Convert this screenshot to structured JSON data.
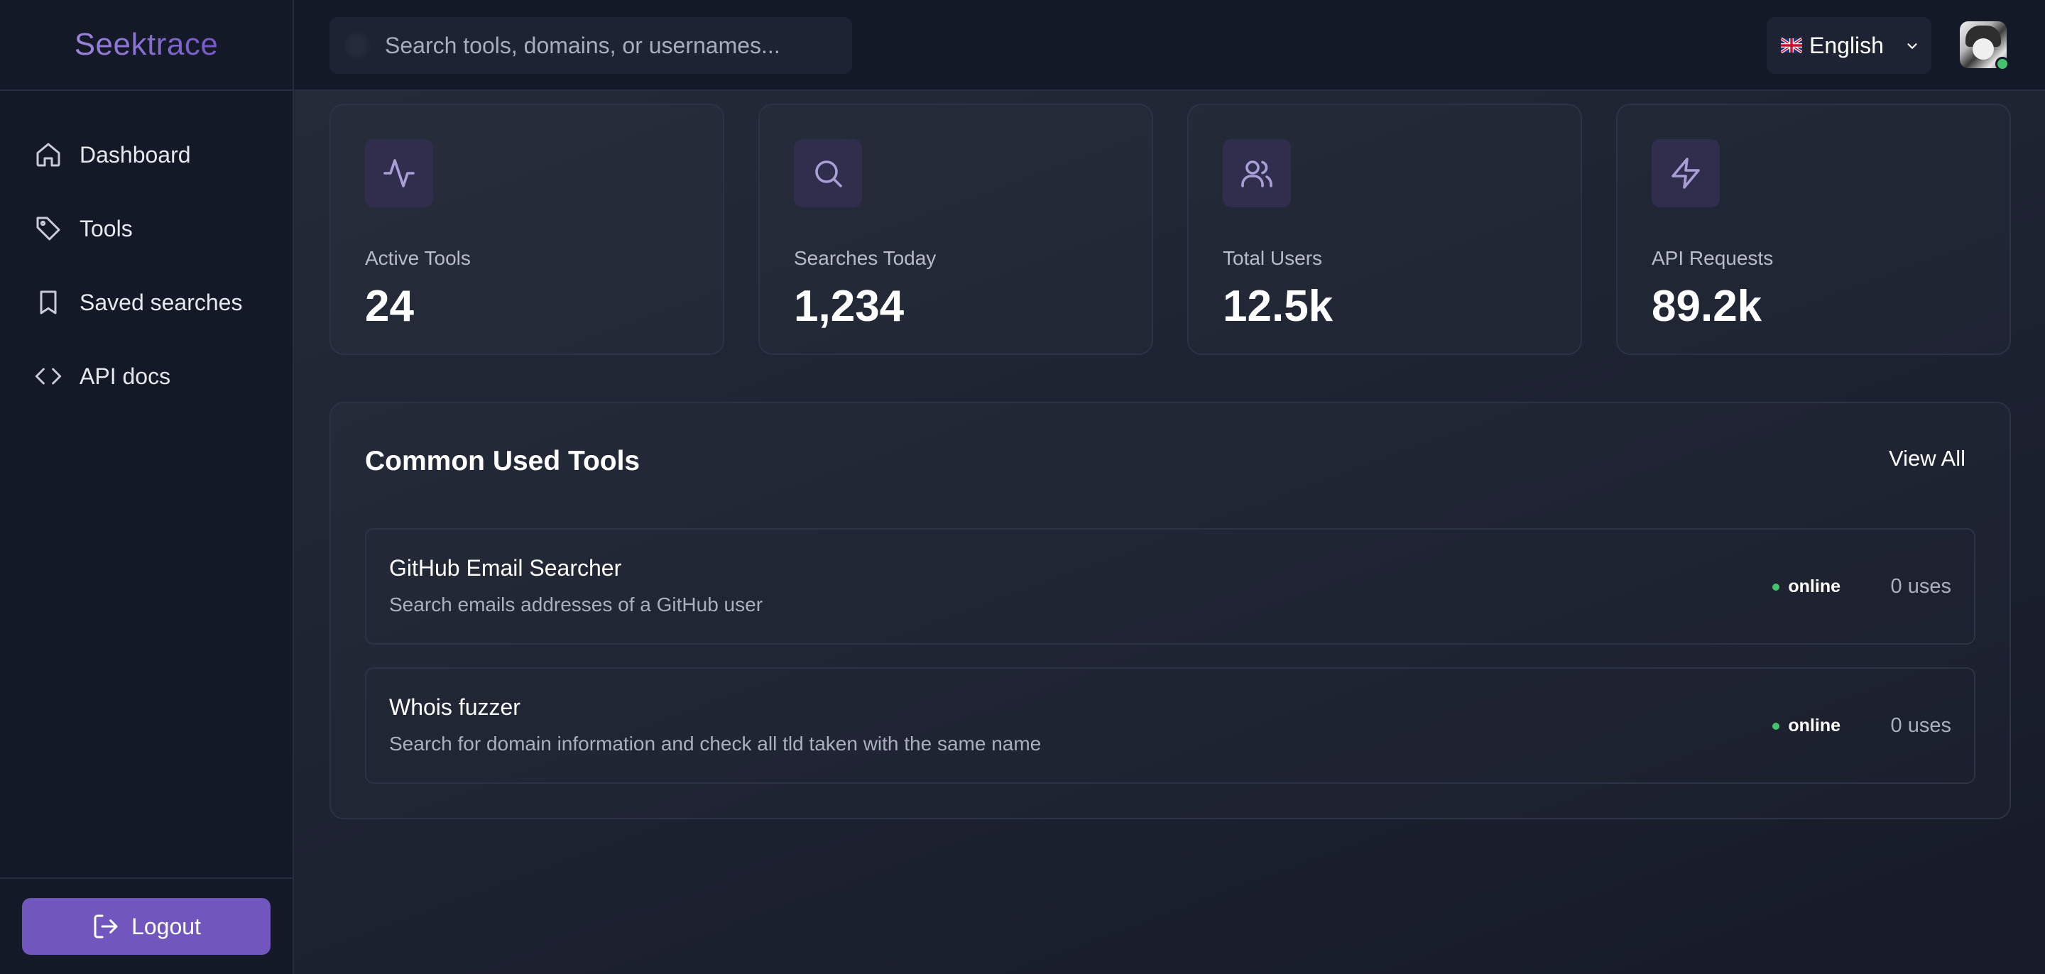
{
  "brand": {
    "name": "Seektrace"
  },
  "sidebar": {
    "items": [
      {
        "label": "Dashboard",
        "icon": "home-icon"
      },
      {
        "label": "Tools",
        "icon": "tag-icon"
      },
      {
        "label": "Saved searches",
        "icon": "bookmark-icon"
      },
      {
        "label": "API docs",
        "icon": "code-icon"
      }
    ],
    "logout_label": "Logout"
  },
  "header": {
    "search_placeholder": "Search tools, domains, or usernames...",
    "language": {
      "selected": "English",
      "flag": "uk-flag-icon"
    },
    "user": {
      "status": "online",
      "status_color": "#45c26c"
    }
  },
  "stats": [
    {
      "label": "Active Tools",
      "value": "24",
      "icon": "activity-icon"
    },
    {
      "label": "Searches Today",
      "value": "1,234",
      "icon": "search-icon"
    },
    {
      "label": "Total Users",
      "value": "12.5k",
      "icon": "users-icon"
    },
    {
      "label": "API Requests",
      "value": "89.2k",
      "icon": "lightning-icon"
    }
  ],
  "tools_panel": {
    "title": "Common Used Tools",
    "view_all_label": "View All",
    "tools": [
      {
        "name": "GitHub Email Searcher",
        "description": "Search emails addresses of a GitHub user",
        "status": "online",
        "uses": "0 uses"
      },
      {
        "name": "Whois fuzzer",
        "description": "Search for domain information and check all tld taken with the same name",
        "status": "online",
        "uses": "0 uses"
      }
    ]
  },
  "colors": {
    "accent": "#7157bd",
    "online": "#45c26c",
    "background": "#1b2130"
  }
}
